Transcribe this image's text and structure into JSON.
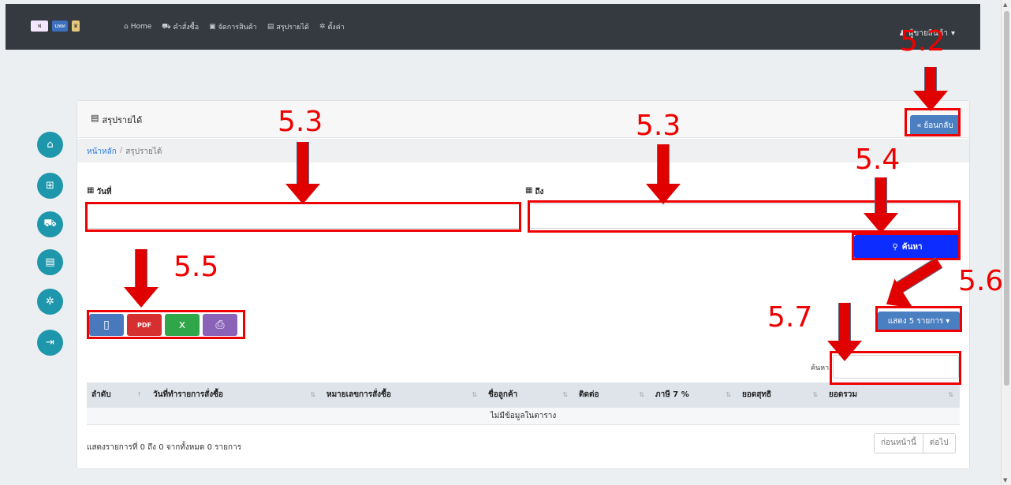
{
  "navbar": {
    "logos": [
      "ฟ",
      "บพท",
      "♛"
    ],
    "links": [
      {
        "icon": "home-icon",
        "glyph": "⌂",
        "label": "Home"
      },
      {
        "icon": "cart-icon",
        "glyph": "⛟",
        "label": "คำสั่งซื้อ"
      },
      {
        "icon": "box-icon",
        "glyph": "▣",
        "label": "จัดการสินค้า"
      },
      {
        "icon": "report-icon",
        "glyph": "▤",
        "label": "สรุปรายได้"
      },
      {
        "icon": "gear-icon",
        "glyph": "✲",
        "label": "ตั้งค่า"
      }
    ],
    "user": "ผู้ขายสินค้า"
  },
  "page": {
    "title": "สรุปรายได้",
    "back_label": "ย้อนกลับ",
    "breadcrumb": {
      "home": "หน้าหลัก",
      "sep": "/",
      "current": "สรุปรายได้"
    },
    "date_from_label": "วันที่",
    "date_to_label": "ถึง",
    "search_label": "ค้นหา",
    "export": {
      "pdf": "PDF"
    },
    "show_label": "แสดง 5 รายการ",
    "table_search_label": "ค้นหา:",
    "columns": [
      "ลำดับ",
      "วันที่ทำรายการสั่งซื้อ",
      "หมายเลขการสั่งซื้อ",
      "ชื่อลูกค้า",
      "ติดต่อ",
      "ภาษี 7 %",
      "ยอดสุทธิ",
      "ยอดรวม"
    ],
    "empty_text": "ไม่มีข้อมูลในตาราง",
    "info": "แสดงรายการที่ 0 ถึง 0 จากทั้งหมด 0 รายการ",
    "prev_label": "ก่อนหน้านี้",
    "next_label": "ต่อไป"
  },
  "annotations": {
    "n52": "5.2",
    "n53a": "5.3",
    "n53b": "5.3",
    "n54": "5.4",
    "n55": "5.5",
    "n56": "5.6",
    "n57": "5.7"
  },
  "colors": {
    "annotation": "#ee0000",
    "navbar": "#343a40",
    "side": "#1e97ad",
    "search": "#0d2cff"
  }
}
